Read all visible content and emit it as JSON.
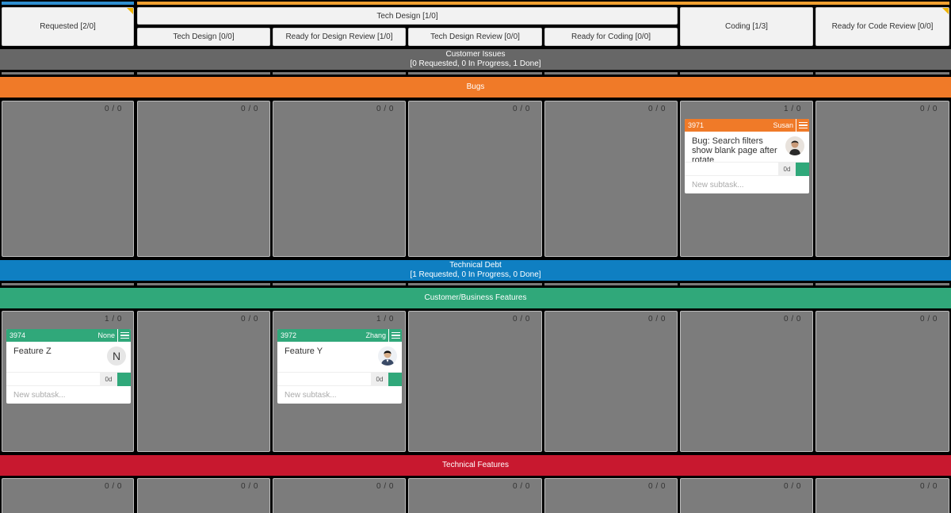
{
  "columns": {
    "requested": "Requested [2/0]",
    "tech_design_group": "Tech Design [1/0]",
    "tech_design_sub": "Tech Design [0/0]",
    "ready_design_review": "Ready for Design Review [1/0]",
    "tech_design_review": "Tech Design Review [0/0]",
    "ready_coding": "Ready for Coding [0/0]",
    "coding": "Coding [1/3]",
    "ready_code_review": "Ready for Code Review [0/0]"
  },
  "swimlanes": {
    "customer_issues": {
      "title": "Customer Issues",
      "summary": "[0 Requested, 0 In Progress, 1 Done]",
      "color": "#676767"
    },
    "bugs": {
      "title": "Bugs",
      "color": "#f07a28"
    },
    "technical_debt": {
      "title": "Technical Debt",
      "summary": "[1 Requested, 0 In Progress, 0 Done]",
      "color": "#0f7fc2"
    },
    "customer_features": {
      "title": "Customer/Business Features",
      "color": "#30a87a"
    },
    "technical_features": {
      "title": "Technical Features",
      "color": "#c8182f"
    }
  },
  "counts": {
    "bugs": [
      "0 / 0",
      "0 / 0",
      "0 / 0",
      "0 / 0",
      "0 / 0",
      "1 / 0",
      "0 / 0"
    ],
    "features": [
      "1 / 0",
      "0 / 0",
      "1 / 0",
      "0 / 0",
      "0 / 0",
      "0 / 0",
      "0 / 0"
    ],
    "technical": [
      "0 / 0",
      "0 / 0",
      "0 / 0",
      "0 / 0",
      "0 / 0",
      "0 / 0",
      "0 / 0"
    ]
  },
  "cards": {
    "c3971": {
      "id": "3971",
      "owner": "Susan",
      "title": "Bug: Search filters show blank page after rotate",
      "estimate": "0d",
      "subtask_placeholder": "New subtask...",
      "color": "#f07a28"
    },
    "c3974": {
      "id": "3974",
      "owner": "None",
      "title": "Feature Z",
      "avatar_letter": "N",
      "estimate": "0d",
      "subtask_placeholder": "New subtask...",
      "color": "#30a87a"
    },
    "c3972": {
      "id": "3972",
      "owner": "Zhang",
      "title": "Feature Y",
      "estimate": "0d",
      "subtask_placeholder": "New subtask...",
      "color": "#30a87a"
    }
  },
  "icons": {
    "card_menu": "hamburger-menu-icon",
    "column_flag": "corner-flag-icon"
  },
  "colors": {
    "topbar_blue": "#2f8fd0",
    "topbar_orange": "#f0a030",
    "estimate_green": "#30a87a"
  }
}
